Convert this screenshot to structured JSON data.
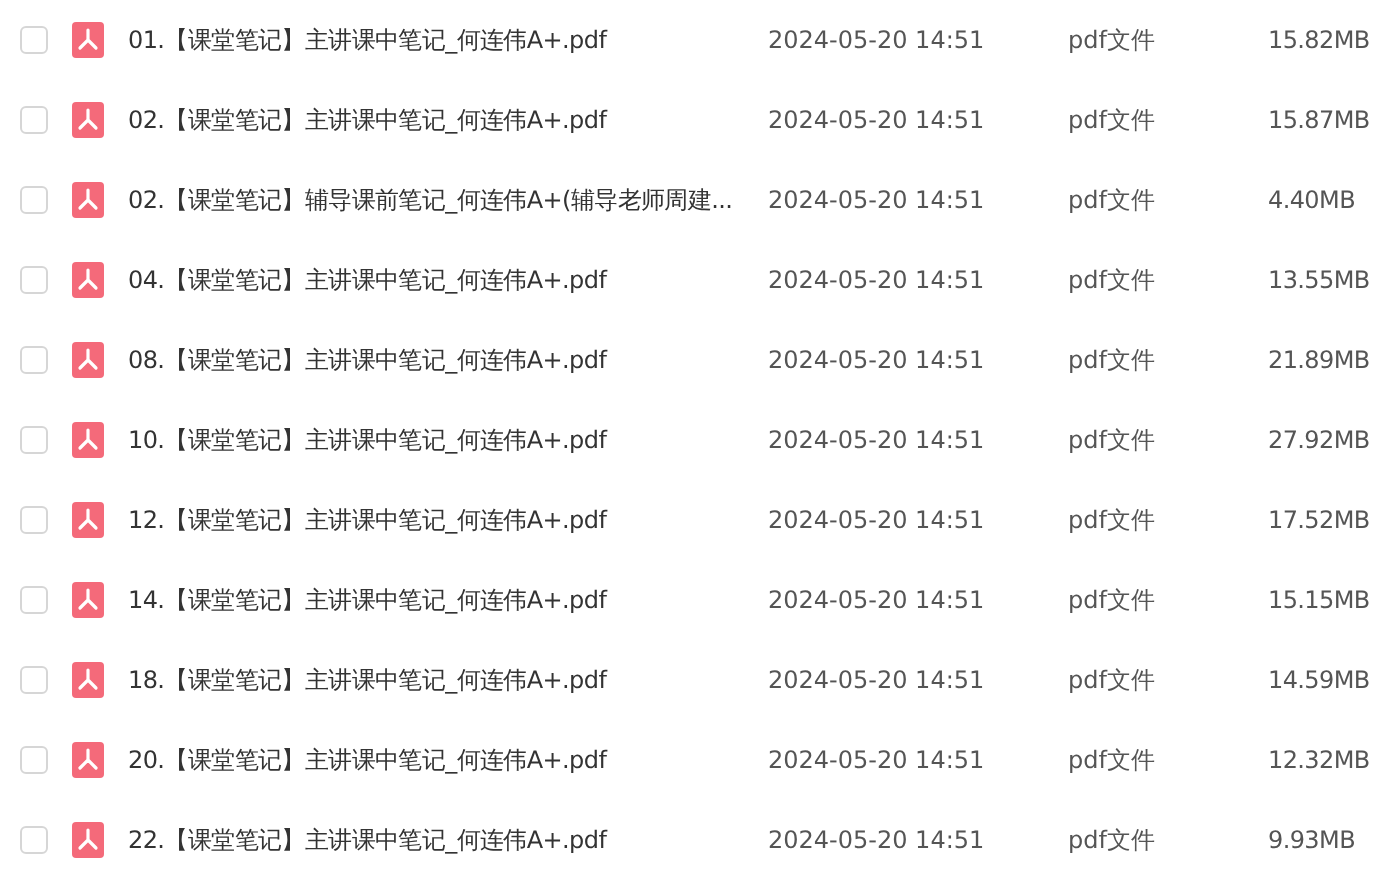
{
  "files": [
    {
      "name": "01.【课堂笔记】主讲课中笔记_何连伟A+.pdf",
      "date": "2024-05-20 14:51",
      "type": "pdf文件",
      "size": "15.82MB",
      "checked": false
    },
    {
      "name": "02.【课堂笔记】主讲课中笔记_何连伟A+.pdf",
      "date": "2024-05-20 14:51",
      "type": "pdf文件",
      "size": "15.87MB",
      "checked": false
    },
    {
      "name": "02.【课堂笔记】辅导课前笔记_何连伟A+(辅导老师周建...",
      "date": "2024-05-20 14:51",
      "type": "pdf文件",
      "size": "4.40MB",
      "checked": false
    },
    {
      "name": "04.【课堂笔记】主讲课中笔记_何连伟A+.pdf",
      "date": "2024-05-20 14:51",
      "type": "pdf文件",
      "size": "13.55MB",
      "checked": false
    },
    {
      "name": "08.【课堂笔记】主讲课中笔记_何连伟A+.pdf",
      "date": "2024-05-20 14:51",
      "type": "pdf文件",
      "size": "21.89MB",
      "checked": false
    },
    {
      "name": "10.【课堂笔记】主讲课中笔记_何连伟A+.pdf",
      "date": "2024-05-20 14:51",
      "type": "pdf文件",
      "size": "27.92MB",
      "checked": false
    },
    {
      "name": "12.【课堂笔记】主讲课中笔记_何连伟A+.pdf",
      "date": "2024-05-20 14:51",
      "type": "pdf文件",
      "size": "17.52MB",
      "checked": false
    },
    {
      "name": "14.【课堂笔记】主讲课中笔记_何连伟A+.pdf",
      "date": "2024-05-20 14:51",
      "type": "pdf文件",
      "size": "15.15MB",
      "checked": false
    },
    {
      "name": "18.【课堂笔记】主讲课中笔记_何连伟A+.pdf",
      "date": "2024-05-20 14:51",
      "type": "pdf文件",
      "size": "14.59MB",
      "checked": false
    },
    {
      "name": "20.【课堂笔记】主讲课中笔记_何连伟A+.pdf",
      "date": "2024-05-20 14:51",
      "type": "pdf文件",
      "size": "12.32MB",
      "checked": false
    },
    {
      "name": "22.【课堂笔记】主讲课中笔记_何连伟A+.pdf",
      "date": "2024-05-20 14:51",
      "type": "pdf文件",
      "size": "9.93MB",
      "checked": false
    }
  ]
}
